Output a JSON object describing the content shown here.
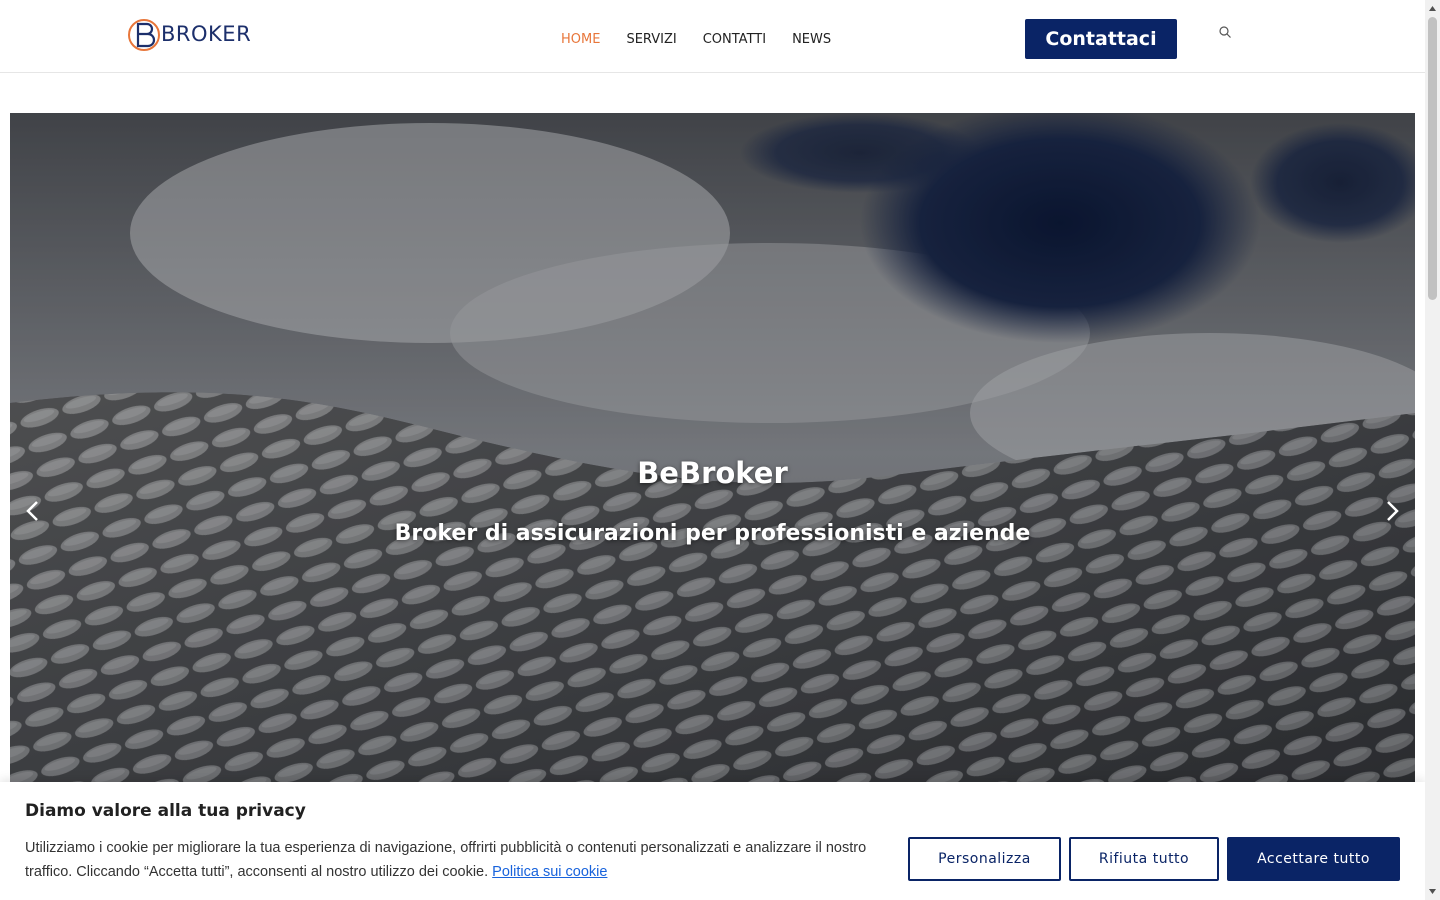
{
  "header": {
    "logo_text": "BROKER",
    "nav": [
      {
        "label": "HOME",
        "active": true
      },
      {
        "label": "SERVIZI",
        "active": false
      },
      {
        "label": "CONTATTI",
        "active": false
      },
      {
        "label": "NEWS",
        "active": false
      }
    ],
    "cta_label": "Contattaci"
  },
  "hero": {
    "title": "BeBroker",
    "subtitle": "Broker di assicurazioni per professionisti e aziende"
  },
  "cookie": {
    "title": "Diamo valore alla tua privacy",
    "text": "Utilizziamo i cookie per migliorare la tua esperienza di navigazione, offrirti pubblicità o contenuti personalizzati e analizzare il nostro traffico. Cliccando “Accetta tutti”, acconsenti al nostro utilizzo dei cookie. ",
    "link": "Politica sui cookie",
    "buttons": {
      "customize": "Personalizza",
      "reject": "Rifiuta tutto",
      "accept": "Accettare tutto"
    }
  },
  "colors": {
    "brand_navy": "#0a2466",
    "nav_active": "#e8763a",
    "link": "#1863dc"
  }
}
